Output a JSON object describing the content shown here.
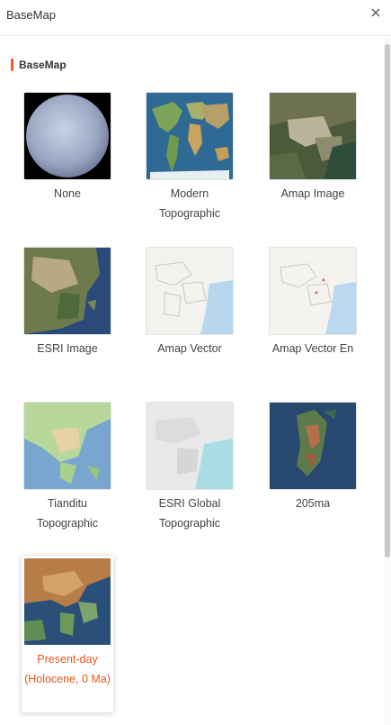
{
  "window": {
    "title": "BaseMap",
    "close_icon": "close-icon"
  },
  "section": {
    "title": "BaseMap",
    "accent_color": "#ff5a1f"
  },
  "selected_color": "#e8561b",
  "basemaps": [
    {
      "label": "None",
      "thumbnail": "globe-sphere",
      "selected": false
    },
    {
      "label": "Modern Topographic",
      "thumbnail": "world-topographic",
      "selected": false
    },
    {
      "label": "Amap Image",
      "thumbnail": "satellite-image",
      "selected": false
    },
    {
      "label": "ESRI Image",
      "thumbnail": "satellite-image",
      "selected": false
    },
    {
      "label": "Amap Vector",
      "thumbnail": "vector-map",
      "selected": false
    },
    {
      "label": "Amap Vector En",
      "thumbnail": "vector-map",
      "selected": false
    },
    {
      "label": "Tianditu Topographic",
      "thumbnail": "topographic-map",
      "selected": false
    },
    {
      "label": "ESRI Global Topographic",
      "thumbnail": "light-topographic",
      "selected": false
    },
    {
      "label": "205ma",
      "thumbnail": "paleo-map",
      "selected": false
    },
    {
      "label": "Present-day (Holocene, 0 Ma)",
      "thumbnail": "paleo-map",
      "selected": true
    }
  ]
}
